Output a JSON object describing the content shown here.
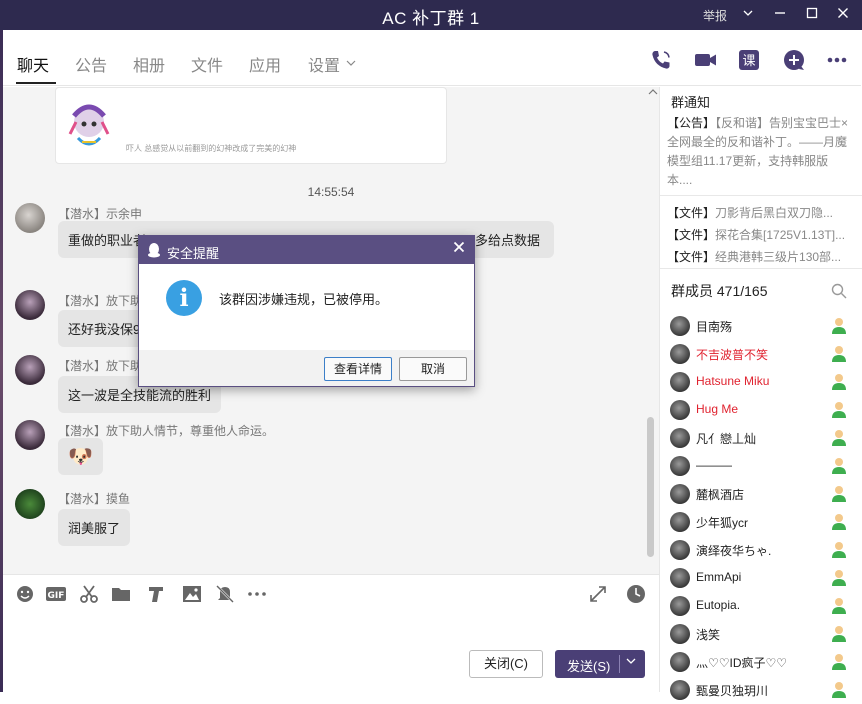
{
  "window": {
    "title": "AC 补丁群 1",
    "report": "举报"
  },
  "tabs": [
    {
      "label": "聊天"
    },
    {
      "label": "公告"
    },
    {
      "label": "相册"
    },
    {
      "label": "文件"
    },
    {
      "label": "应用"
    },
    {
      "label": "设置"
    }
  ],
  "chat": {
    "sticker_caption": "吓人 总感觉从以前翻到的幻神改成了完美的幻神",
    "timestamp": "14:55:54",
    "messages": [
      {
        "sender": "【潜水】示余申",
        "text": "重做的职业者",
        "text_tail": "多给点数据"
      },
      {
        "sender": "【潜水】放下助",
        "text": "还好我没保9"
      },
      {
        "sender": "【潜水】放下助",
        "text": "这一波是全技能流的胜利"
      },
      {
        "sender": "【潜水】放下助人情节，尊重他人命运。",
        "text": "🐶"
      },
      {
        "sender": "【潜水】摸鱼",
        "text": "润美服了"
      }
    ]
  },
  "compose": {
    "close_label": "关闭(C)",
    "send_label": "发送(S)"
  },
  "sidebar": {
    "notice_title": "群通知",
    "notice_tag": "【公告】",
    "notice_text": "【反和谐】告别宝宝巴士×全网最全的反和谐补丁。——月魔模型组11.17更新，支持韩服版本....",
    "files": [
      {
        "tag": "【文件】",
        "name": "刀影背后黑白双刀隐..."
      },
      {
        "tag": "【文件】",
        "name": "探花合集[1725V1.13T]..."
      },
      {
        "tag": "【文件】",
        "name": "经典港韩三级片130部..."
      }
    ],
    "members_label": "群成员 471/165",
    "members": [
      {
        "name": "目南殇",
        "red": false
      },
      {
        "name": "不吉波普不笑",
        "red": true
      },
      {
        "name": "Hatsune Miku",
        "red": true
      },
      {
        "name": "Hug Me",
        "red": true
      },
      {
        "name": "凡亻戀丄灿",
        "red": false
      },
      {
        "name": "———",
        "red": false
      },
      {
        "name": "麓枫酒店",
        "red": false
      },
      {
        "name": "少年狐ycr",
        "red": false
      },
      {
        "name": "演绎夜华ちゃ.",
        "red": false
      },
      {
        "name": "EmmApi",
        "red": false
      },
      {
        "name": "Eutopia.",
        "red": false
      },
      {
        "name": "浅笑",
        "red": false
      },
      {
        "name": "灬♡♡ID疯子♡♡",
        "red": false
      },
      {
        "name": "甄曼贝独玥川",
        "red": false
      }
    ]
  },
  "dialog": {
    "title": "安全提醒",
    "message": "该群因涉嫌违规，已被停用。",
    "details_label": "查看详情",
    "cancel_label": "取消",
    "info_icon": "i"
  }
}
